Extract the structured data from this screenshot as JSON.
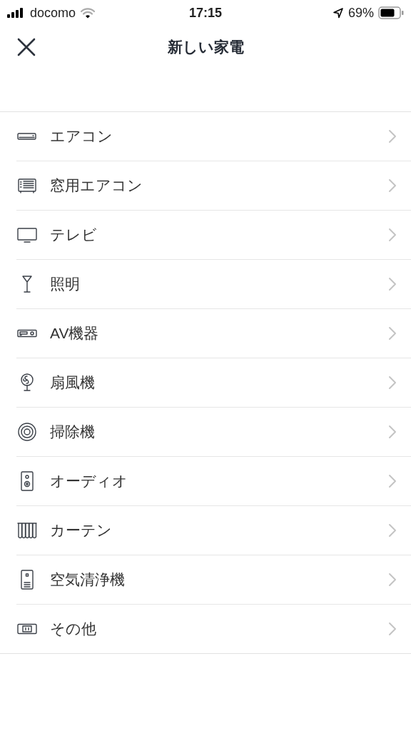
{
  "status_bar": {
    "carrier": "docomo",
    "time": "17:15",
    "battery": "69%"
  },
  "header": {
    "title": "新しい家電"
  },
  "appliances": [
    {
      "kind": "aircon",
      "label": "エアコン"
    },
    {
      "kind": "window_aircon",
      "label": "窓用エアコン"
    },
    {
      "kind": "tv",
      "label": "テレビ"
    },
    {
      "kind": "light",
      "label": "照明"
    },
    {
      "kind": "av",
      "label": "AV機器"
    },
    {
      "kind": "fan",
      "label": "扇風機"
    },
    {
      "kind": "vacuum",
      "label": "掃除機"
    },
    {
      "kind": "audio",
      "label": "オーディオ"
    },
    {
      "kind": "curtain",
      "label": "カーテン"
    },
    {
      "kind": "purifier",
      "label": "空気清浄機"
    },
    {
      "kind": "other",
      "label": "その他"
    }
  ]
}
